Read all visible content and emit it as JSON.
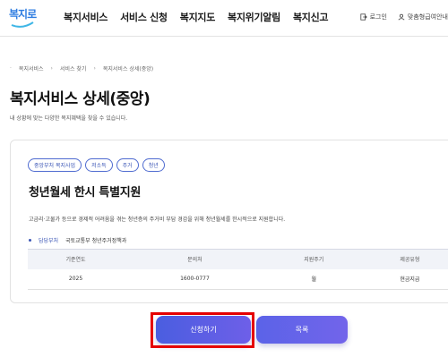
{
  "header": {
    "logo_text": "복지로",
    "nav": [
      "복지서비스",
      "서비스 신청",
      "복지지도",
      "복지위기알림",
      "복지신고"
    ],
    "login": "로그인",
    "user": "맞춤형급여안내"
  },
  "breadcrumb": [
    "복지서비스",
    "서비스 찾기",
    "복지서비스 상세(중앙)"
  ],
  "page": {
    "title": "복지서비스 상세(중앙)",
    "subtitle": "내 상황에 맞는 다양한 복지혜택을 찾을 수 있습니다."
  },
  "service": {
    "tags": [
      "중앙부처 복지사업",
      "저소득",
      "주거",
      "청년"
    ],
    "title": "청년월세 한시 특별지원",
    "description": "고금리·고물가 등으로 경제적 어려움을 겪는 청년층의 주거비 부담 경감을 위해 청년월세를 한시적으로 지원합니다.",
    "dept_label": "담당부처",
    "dept_value": "국토교통부 청년주거정책과",
    "table": {
      "headers": [
        "기준연도",
        "문의처",
        "지원주기",
        "제공유형"
      ],
      "row": [
        "2025",
        "1600-0777",
        "월",
        "현금지급"
      ]
    }
  },
  "buttons": {
    "apply": "신청하기",
    "list": "목록"
  }
}
